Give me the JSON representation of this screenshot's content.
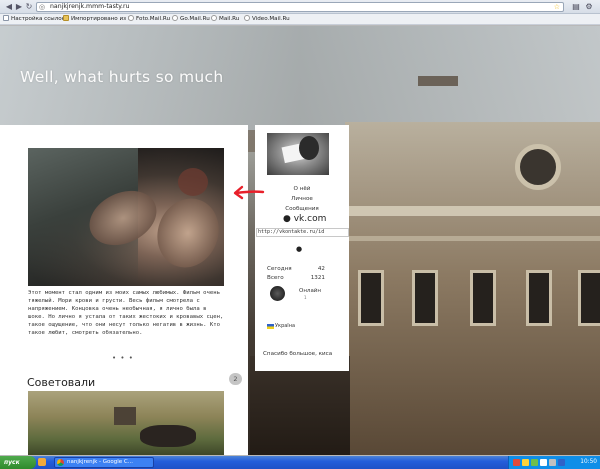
{
  "browser": {
    "url": "nanjkjrenjk.mmm-tasty.ru",
    "back_icon": "arrow-left",
    "forward_icon": "arrow-right",
    "reload_icon": "reload",
    "bookmarks": [
      {
        "label": "Настройка ссылок",
        "icon": "page"
      },
      {
        "label": "Импортировано из IE",
        "icon": "folder"
      },
      {
        "label": "Foto.Mail.Ru",
        "icon": "at"
      },
      {
        "label": "Go.Mail.Ru",
        "icon": "at"
      },
      {
        "label": "Mail.Ru",
        "icon": "at"
      },
      {
        "label": "Video.Mail.Ru",
        "icon": "at"
      }
    ]
  },
  "page": {
    "site_title": "Well, what hurts so much",
    "post": {
      "text": "Этот момент стал одним из моих самых любимых. Фильм очень тяжелый. Мори крови и грусти. Весь фильм смотрела с напряжением. Концовка очень необычная, я лично была в шоке. Но лично я устала от таких жестоких и кровавых сцен, такое ощущение, что они несут только негатив в жизнь. Кто такое любит, смотреть обязательно.",
      "more": "• • •"
    },
    "recommended": {
      "title": "Советовали",
      "count": "2"
    }
  },
  "sidebar": {
    "line1": "О нёй",
    "line2": "Личное",
    "line3": "Сообщения",
    "vk_label": "vk.com",
    "vk_url": "http://vkontakte.ru/id",
    "stats": [
      {
        "label": "Сегодня",
        "value": "42"
      },
      {
        "label": "Всего",
        "value": "1321"
      }
    ],
    "online_label": "Онлайн",
    "online_sub": "1",
    "country": "Україна",
    "thanks": "Спасибо большое, киса"
  },
  "taskbar": {
    "start": "пуск",
    "task_label": "nanjkjrenjk - Google C...",
    "clock": "10:50"
  },
  "colors": {
    "annotation_arrow": "#e8202a",
    "taskbar": "#245edb"
  }
}
